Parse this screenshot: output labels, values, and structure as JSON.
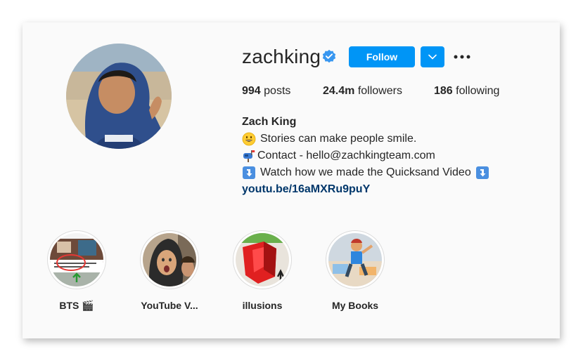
{
  "profile": {
    "username": "zachking",
    "verified_icon": "verified-badge-icon",
    "follow_label": "Follow",
    "dropdown_icon": "chevron-down-icon",
    "more_icon": "more-options-icon",
    "avatar_icon": "profile-photo"
  },
  "stats": {
    "posts_count": "994",
    "posts_label": "posts",
    "followers_count": "24.4m",
    "followers_label": "followers",
    "following_count": "186",
    "following_label": "following"
  },
  "bio": {
    "name": "Zach King",
    "line1": "Stories can make people smile.",
    "line2": "Contact - hello@zachkingteam.com",
    "line3": "Watch how we made the Quicksand Video",
    "link": "youtu.be/16aMXRu9puY"
  },
  "highlights": [
    {
      "label": "BTS 🎬"
    },
    {
      "label": "YouTube V..."
    },
    {
      "label": "illusions"
    },
    {
      "label": "My Books"
    }
  ],
  "colors": {
    "accent": "#0095f6",
    "link": "#00376b",
    "text": "#262626",
    "card_bg": "#fafafa"
  }
}
